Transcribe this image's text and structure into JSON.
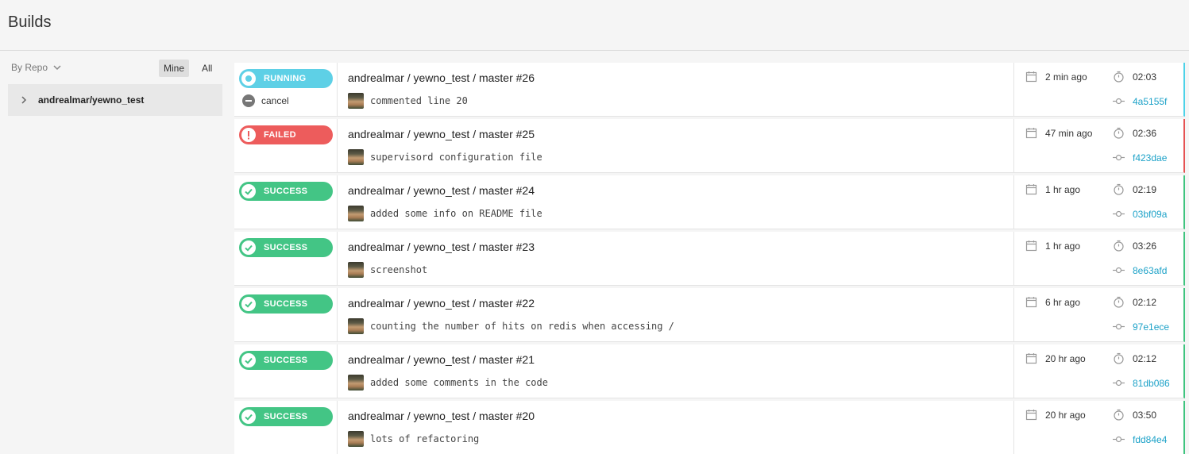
{
  "header": {
    "title": "Builds"
  },
  "sidebar": {
    "filter_label": "By Repo",
    "mine_label": "Mine",
    "all_label": "All",
    "repos": [
      {
        "label": "andrealmar/yewno_test"
      }
    ]
  },
  "colors": {
    "running": "#5ed0e6",
    "failed": "#ed5c5c",
    "success": "#43c585",
    "commit_link": "#1da2c8"
  },
  "builds": [
    {
      "status": "running",
      "badge": "RUNNING",
      "cancel_label": "cancel",
      "title": "andrealmar / yewno_test / master #26",
      "message": "commented line 20",
      "time_ago": "2 min ago",
      "duration": "02:03",
      "commit": "4a5155f"
    },
    {
      "status": "failed",
      "badge": "FAILED",
      "title": "andrealmar / yewno_test / master #25",
      "message": "supervisord configuration file",
      "time_ago": "47 min ago",
      "duration": "02:36",
      "commit": "f423dae"
    },
    {
      "status": "success",
      "badge": "SUCCESS",
      "title": "andrealmar / yewno_test / master #24",
      "message": "added some info on README file",
      "time_ago": "1 hr ago",
      "duration": "02:19",
      "commit": "03bf09a"
    },
    {
      "status": "success",
      "badge": "SUCCESS",
      "title": "andrealmar / yewno_test / master #23",
      "message": "screenshot",
      "time_ago": "1 hr ago",
      "duration": "03:26",
      "commit": "8e63afd"
    },
    {
      "status": "success",
      "badge": "SUCCESS",
      "title": "andrealmar / yewno_test / master #22",
      "message": "counting the number of hits on redis when accessing /",
      "time_ago": "6 hr ago",
      "duration": "02:12",
      "commit": "97e1ece"
    },
    {
      "status": "success",
      "badge": "SUCCESS",
      "title": "andrealmar / yewno_test / master #21",
      "message": "added some comments in the code",
      "time_ago": "20 hr ago",
      "duration": "02:12",
      "commit": "81db086"
    },
    {
      "status": "success",
      "badge": "SUCCESS",
      "title": "andrealmar / yewno_test / master #20",
      "message": "lots of refactoring",
      "time_ago": "20 hr ago",
      "duration": "03:50",
      "commit": "fdd84e4"
    }
  ]
}
